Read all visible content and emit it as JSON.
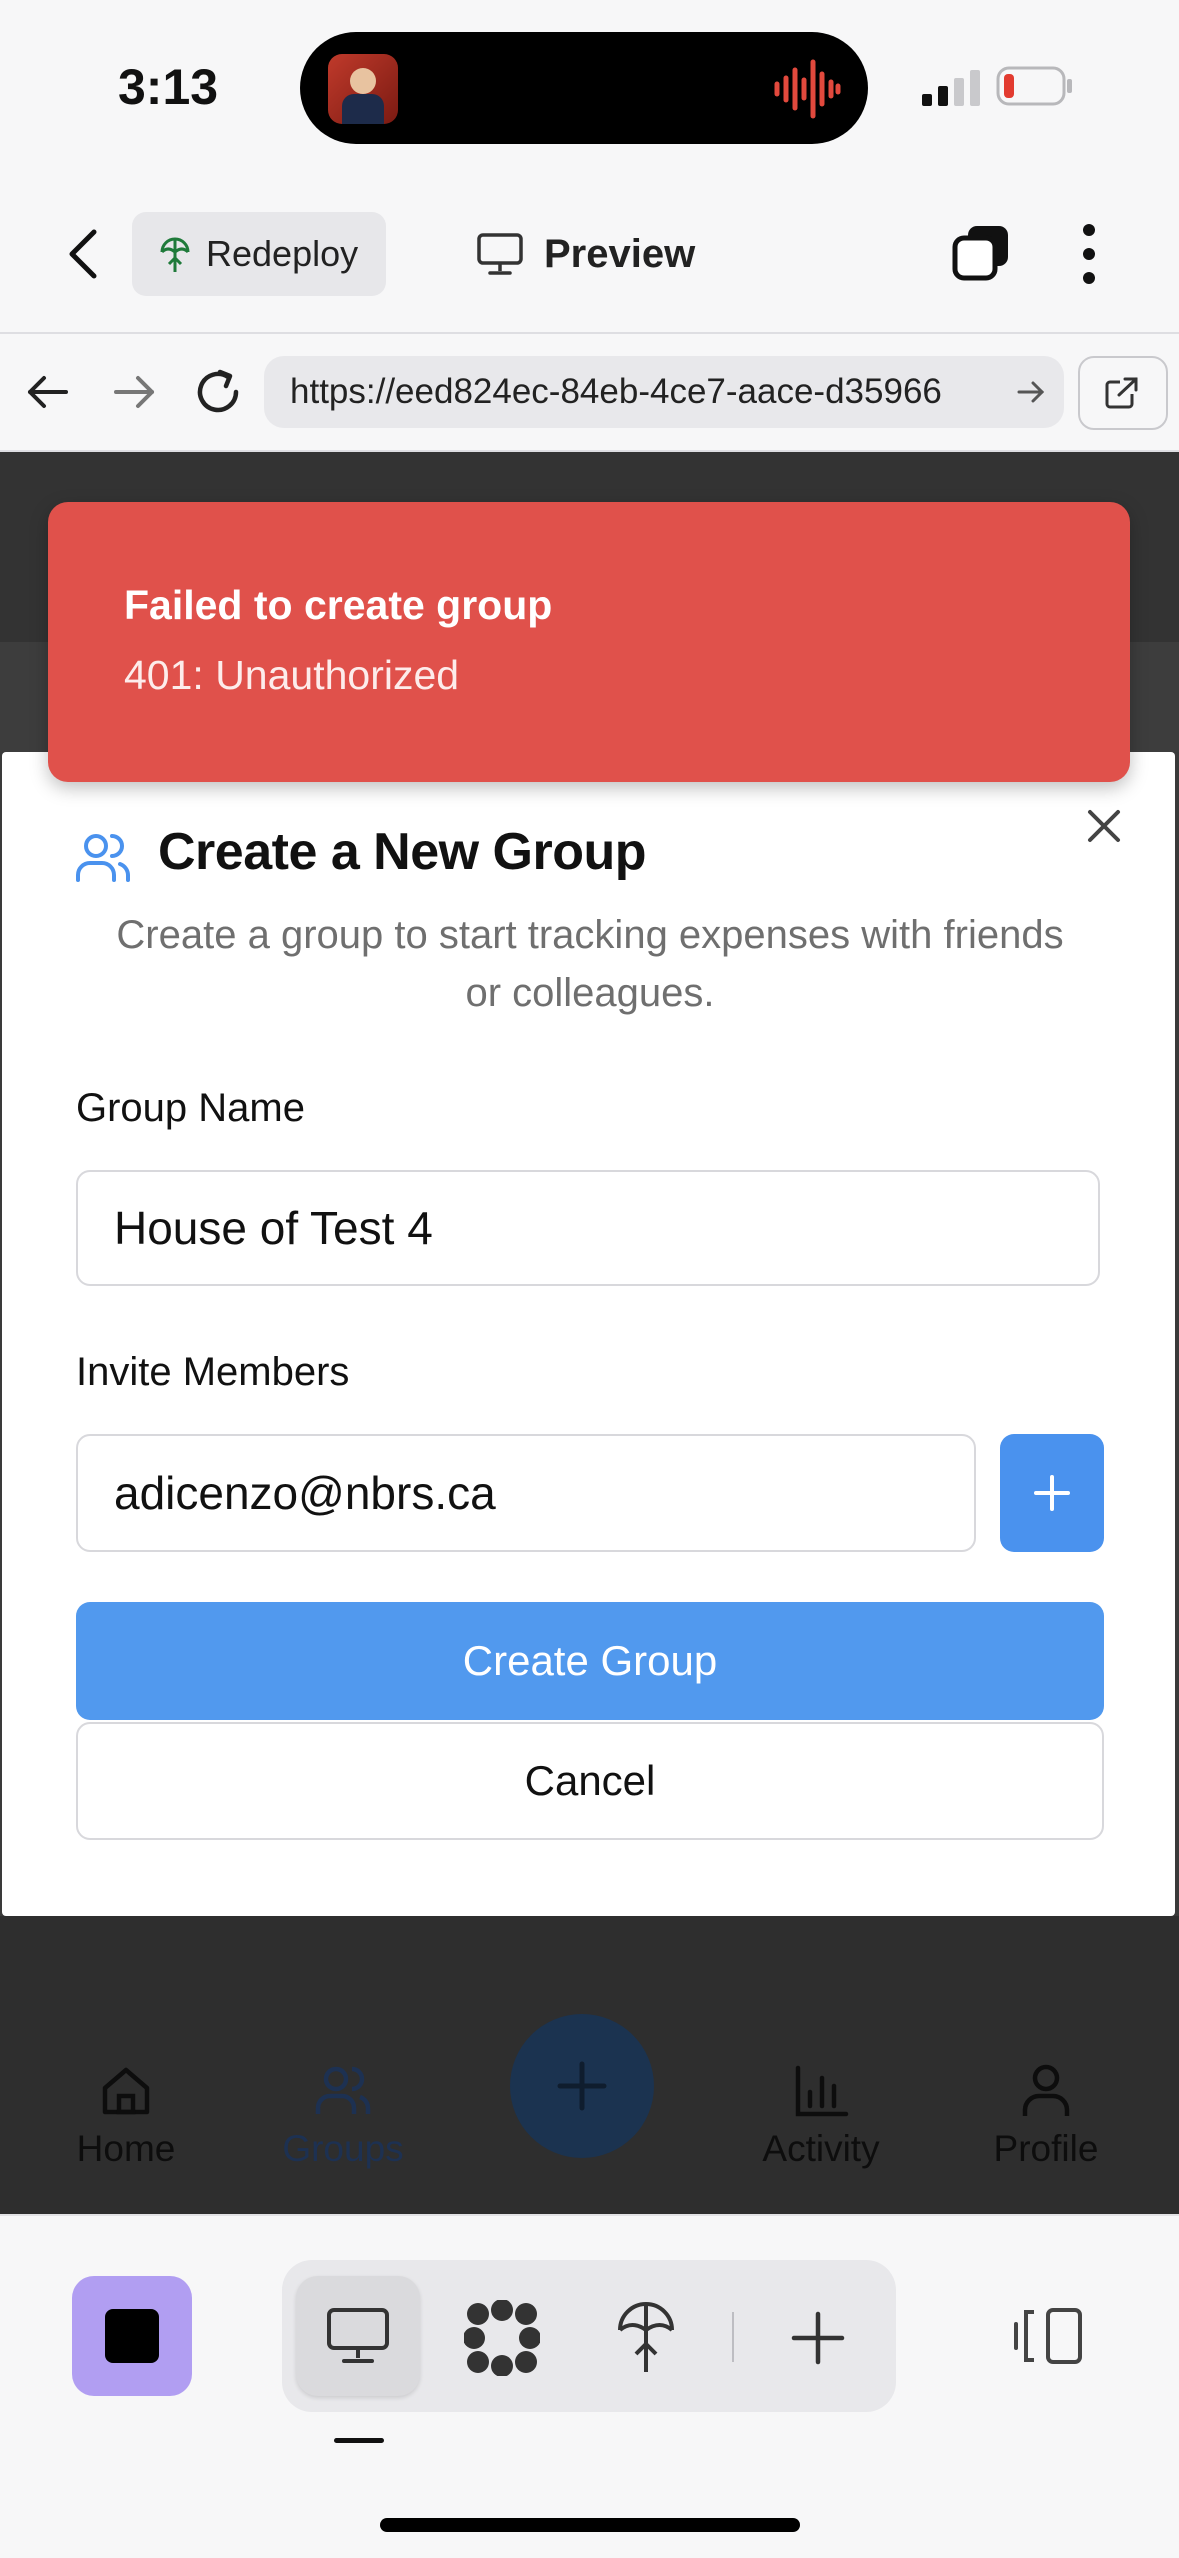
{
  "status_bar": {
    "time": "3:13"
  },
  "header": {
    "redeploy_label": "Redeploy",
    "preview_label": "Preview"
  },
  "browser": {
    "url": "https://eed824ec-84eb-4ce7-aace-d35966"
  },
  "toast": {
    "title": "Failed to create group",
    "message": "401: Unauthorized",
    "color": "#e0514b"
  },
  "modal": {
    "title": "Create a New Group",
    "subtitle": "Create a group to start tracking expenses with friends or colleagues.",
    "group_name_label": "Group Name",
    "group_name_value": "House of Test 4",
    "invite_label": "Invite Members",
    "invite_value": "adicenzo@nbrs.ca",
    "create_label": "Create Group",
    "cancel_label": "Cancel",
    "accent": "#5199ee"
  },
  "app_nav": {
    "items": [
      {
        "label": "Home",
        "icon": "home-icon"
      },
      {
        "label": "Groups",
        "icon": "users-icon"
      },
      {
        "label": "Activity",
        "icon": "bar-chart-icon"
      },
      {
        "label": "Profile",
        "icon": "user-icon"
      }
    ],
    "fab_icon": "plus-icon"
  },
  "toolbar": {
    "icons": [
      "app-tile-icon",
      "desktop-icon",
      "flower-icon",
      "deploy-icon",
      "plus-icon",
      "split-view-icon"
    ]
  }
}
